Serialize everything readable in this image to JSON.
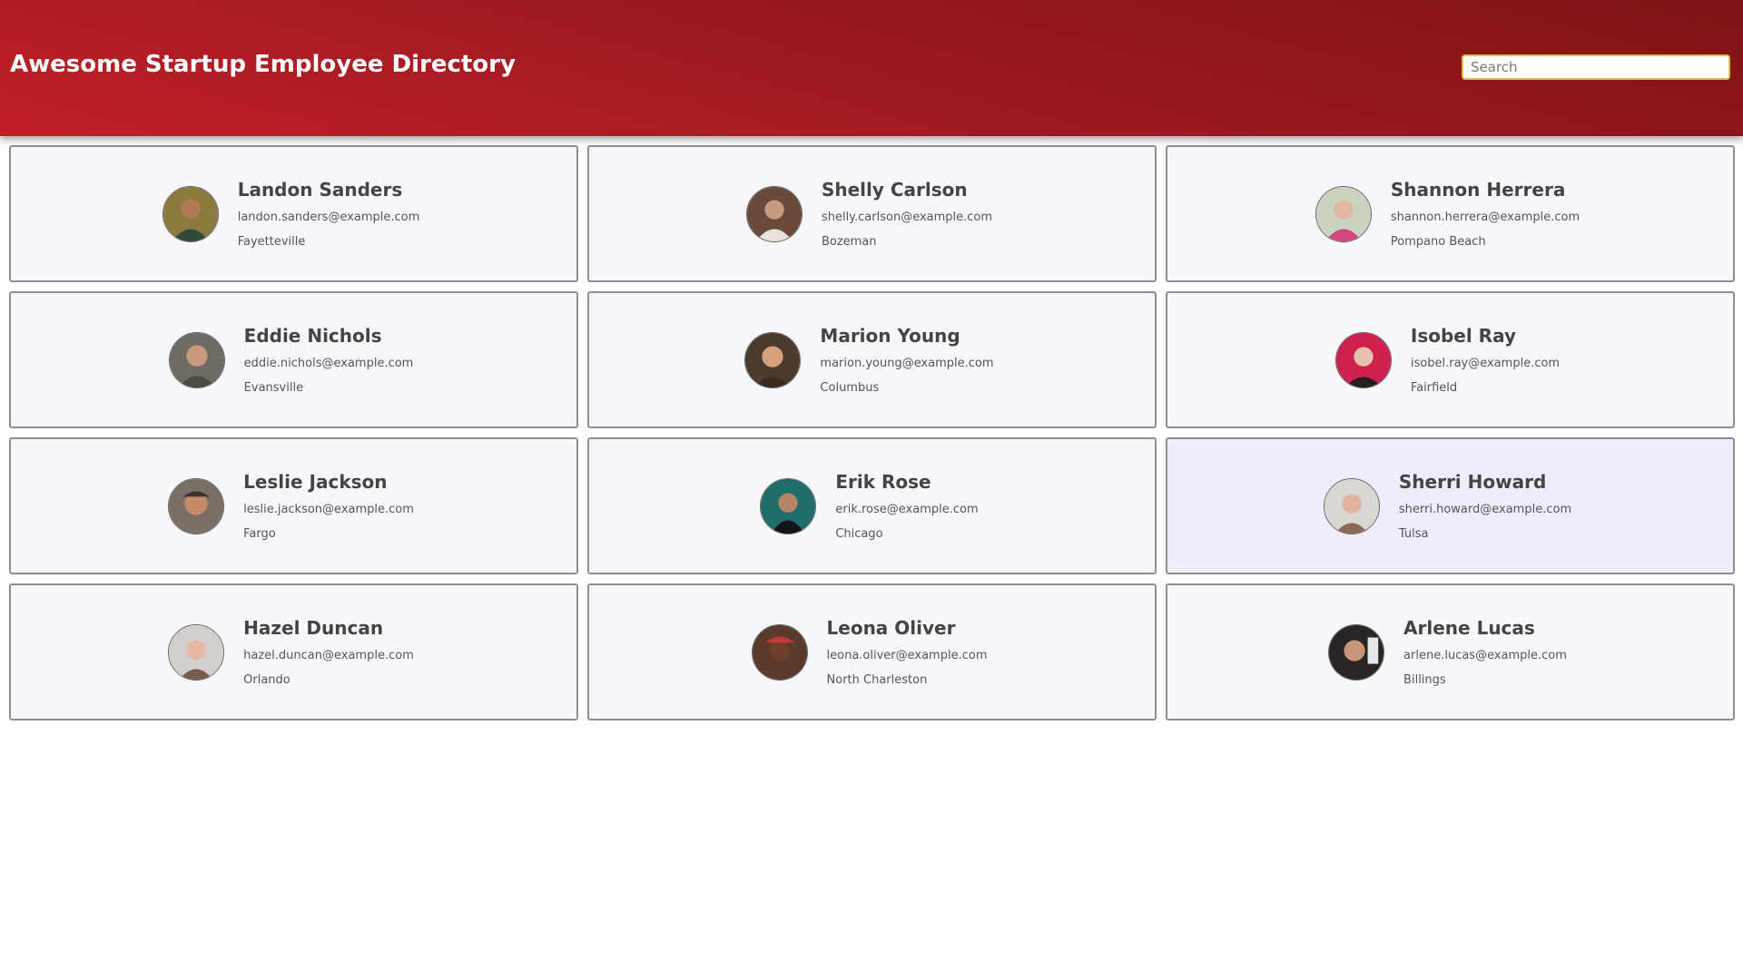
{
  "header": {
    "title": "Awesome Startup Employee Directory",
    "search_placeholder": "Search"
  },
  "colors": {
    "header_red": "#b01e25",
    "card_bg": "#f7f8fc",
    "card_hover_bg": "#eeedfb",
    "card_border": "#8f8f8f"
  },
  "employees": [
    {
      "name": "Landon Sanders",
      "email": "landon.sanders@example.com",
      "city": "Fayetteville",
      "avatar": "avatar-photo-icon"
    },
    {
      "name": "Shelly Carlson",
      "email": "shelly.carlson@example.com",
      "city": "Bozeman",
      "avatar": "avatar-photo-icon"
    },
    {
      "name": "Shannon Herrera",
      "email": "shannon.herrera@example.com",
      "city": "Pompano Beach",
      "avatar": "avatar-photo-icon"
    },
    {
      "name": "Eddie Nichols",
      "email": "eddie.nichols@example.com",
      "city": "Evansville",
      "avatar": "avatar-photo-icon"
    },
    {
      "name": "Marion Young",
      "email": "marion.young@example.com",
      "city": "Columbus",
      "avatar": "avatar-photo-icon"
    },
    {
      "name": "Isobel Ray",
      "email": "isobel.ray@example.com",
      "city": "Fairfield",
      "avatar": "avatar-photo-icon"
    },
    {
      "name": "Leslie Jackson",
      "email": "leslie.jackson@example.com",
      "city": "Fargo",
      "avatar": "avatar-photo-icon"
    },
    {
      "name": "Erik Rose",
      "email": "erik.rose@example.com",
      "city": "Chicago",
      "avatar": "avatar-photo-icon"
    },
    {
      "name": "Sherri Howard",
      "email": "sherri.howard@example.com",
      "city": "Tulsa",
      "avatar": "avatar-photo-icon",
      "highlighted": true
    },
    {
      "name": "Hazel Duncan",
      "email": "hazel.duncan@example.com",
      "city": "Orlando",
      "avatar": "avatar-photo-icon"
    },
    {
      "name": "Leona Oliver",
      "email": "leona.oliver@example.com",
      "city": "North Charleston",
      "avatar": "avatar-photo-icon"
    },
    {
      "name": "Arlene Lucas",
      "email": "arlene.lucas@example.com",
      "city": "Billings",
      "avatar": "avatar-photo-icon"
    }
  ]
}
